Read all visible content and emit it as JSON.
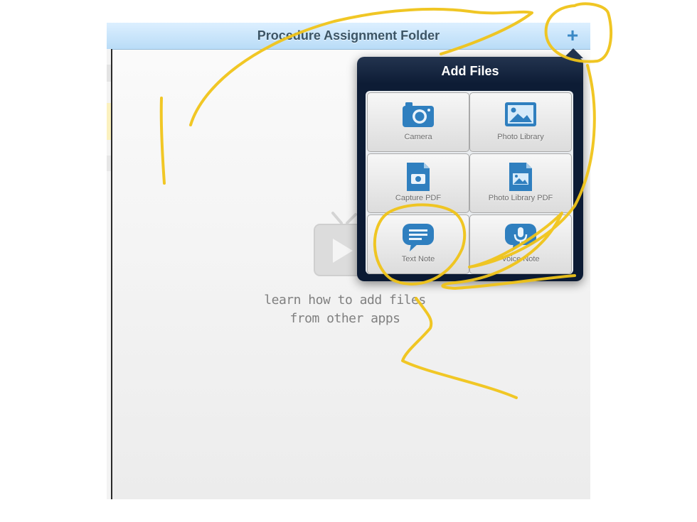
{
  "navbar": {
    "title": "Procedure Assignment Folder",
    "add_button_label": "+"
  },
  "empty_state": {
    "hint_line_1": "learn how to add files",
    "hint_line_2": "from other apps",
    "video_icon": "tv-play-icon"
  },
  "add_files_popover": {
    "title": "Add Files",
    "options": [
      {
        "label": "Camera",
        "icon": "camera-icon"
      },
      {
        "label": "Photo Library",
        "icon": "photo-library-icon"
      },
      {
        "label": "Capture PDF",
        "icon": "capture-pdf-icon"
      },
      {
        "label": "Photo Library PDF",
        "icon": "photo-library-pdf-icon"
      },
      {
        "label": "Text Note",
        "icon": "text-note-icon"
      },
      {
        "label": "Voice Note",
        "icon": "voice-note-icon"
      }
    ]
  },
  "colors": {
    "navbar_bg": "#c9e5fb",
    "accent": "#3a88c5",
    "popover_bg": "#0d1c35",
    "annotation_ink": "#f0c419"
  }
}
